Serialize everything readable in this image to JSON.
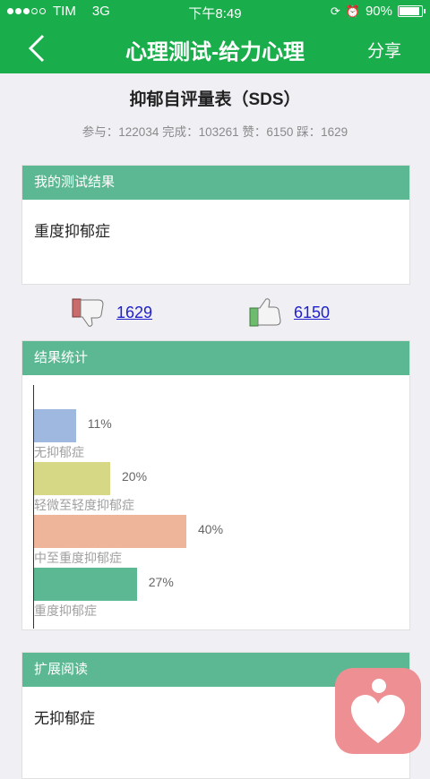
{
  "status": {
    "carrier": "TIM",
    "network": "3G",
    "time": "下午8:49",
    "battery": "90%",
    "battery_level": 0.9
  },
  "nav": {
    "title": "心理测试-给力心理",
    "share": "分享"
  },
  "page": {
    "title": "抑郁自评量表（SDS）",
    "stats": "参与：122034 完成：103261 赞：6150 踩：1629"
  },
  "result": {
    "header": "我的测试结果",
    "text": "重度抑郁症"
  },
  "votes": {
    "dislike": "1629",
    "like": "6150"
  },
  "stats_section": {
    "header": "结果统计"
  },
  "chart_data": {
    "type": "bar",
    "orientation": "horizontal",
    "categories": [
      "无抑郁症",
      "轻微至轻度抑郁症",
      "中至重度抑郁症",
      "重度抑郁症"
    ],
    "values": [
      11,
      20,
      40,
      27
    ],
    "value_labels": [
      "11%",
      "20%",
      "40%",
      "27%"
    ],
    "colors": [
      "#9fb8e0",
      "#d7d886",
      "#efb59b",
      "#5bb893"
    ],
    "unit": "%"
  },
  "reading": {
    "header": "扩展阅读",
    "text": "无抑郁症"
  },
  "icons": {
    "back": "back-chevron-icon",
    "dislike": "thumbs-down-icon",
    "like": "thumbs-up-icon",
    "app": "heart-logo-icon"
  }
}
